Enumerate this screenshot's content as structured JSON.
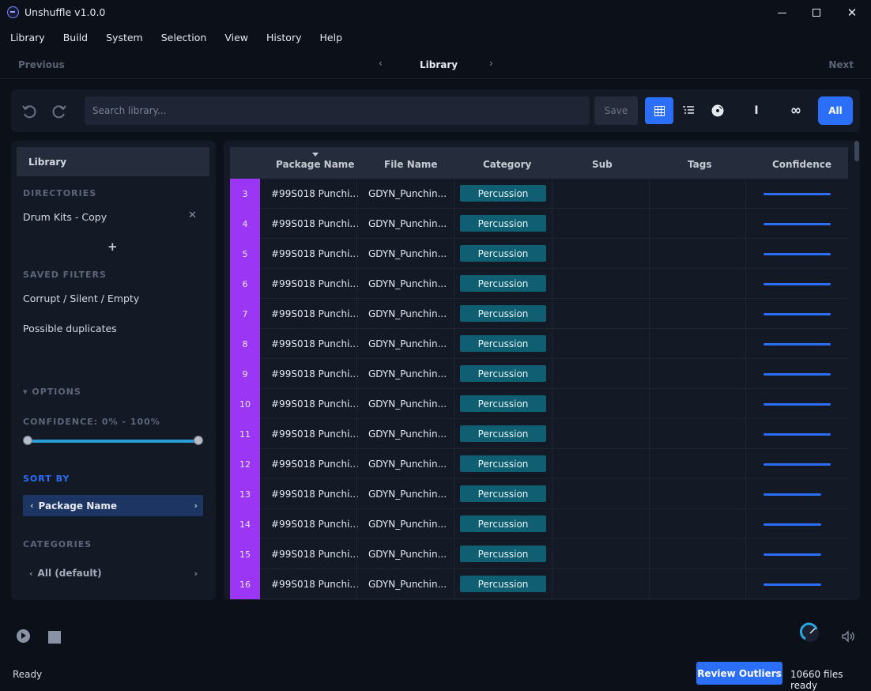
{
  "window": {
    "title": "Unshuffle v1.0.0"
  },
  "menu": [
    "Library",
    "Build",
    "System",
    "Selection",
    "View",
    "History",
    "Help"
  ],
  "nav": {
    "previous": "Previous",
    "title": "Library",
    "next": "Next"
  },
  "toolbar": {
    "search_placeholder": "Search library...",
    "save_label": "Save",
    "one_label": "I",
    "infinity_label": "∞",
    "all_label": "All",
    "accent": "#2b6ef7"
  },
  "sidebar": {
    "header": "Library",
    "directories_title": "DIRECTORIES",
    "directory_item": "Drum Kits - Copy",
    "add_label": "+",
    "saved_filters_title": "SAVED FILTERS",
    "saved_filters": [
      "Corrupt / Silent / Empty",
      "Possible duplicates"
    ],
    "options_title": "▾ OPTIONS",
    "confidence_title": "CONFIDENCE: 0% - 100%",
    "confidence_min": 0,
    "confidence_max": 100,
    "sort_by_title": "SORT BY",
    "sort_by_value": "Package Name",
    "categories_title": "CATEGORIES",
    "categories_value": "All (default)"
  },
  "table": {
    "columns": [
      "Package Name",
      "File Name",
      "Category",
      "Sub",
      "Tags",
      "Confidence"
    ],
    "row_accent": "#9b37f4",
    "category_color": "#0f5e72",
    "rows": [
      {
        "num": "3",
        "package": "#99S018 Punchi...",
        "file": "GDYN_Punchin...",
        "category": "Percussion",
        "confidence": 1.0
      },
      {
        "num": "4",
        "package": "#99S018 Punchi...",
        "file": "GDYN_Punchin...",
        "category": "Percussion",
        "confidence": 1.0
      },
      {
        "num": "5",
        "package": "#99S018 Punchi...",
        "file": "GDYN_Punchin...",
        "category": "Percussion",
        "confidence": 1.0
      },
      {
        "num": "6",
        "package": "#99S018 Punchi...",
        "file": "GDYN_Punchin...",
        "category": "Percussion",
        "confidence": 1.0
      },
      {
        "num": "7",
        "package": "#99S018 Punchi...",
        "file": "GDYN_Punchin...",
        "category": "Percussion",
        "confidence": 1.0
      },
      {
        "num": "8",
        "package": "#99S018 Punchi...",
        "file": "GDYN_Punchin...",
        "category": "Percussion",
        "confidence": 1.0
      },
      {
        "num": "9",
        "package": "#99S018 Punchi...",
        "file": "GDYN_Punchin...",
        "category": "Percussion",
        "confidence": 1.0
      },
      {
        "num": "10",
        "package": "#99S018 Punchi...",
        "file": "GDYN_Punchin...",
        "category": "Percussion",
        "confidence": 1.0
      },
      {
        "num": "11",
        "package": "#99S018 Punchi...",
        "file": "GDYN_Punchin...",
        "category": "Percussion",
        "confidence": 1.0
      },
      {
        "num": "12",
        "package": "#99S018 Punchi...",
        "file": "GDYN_Punchin...",
        "category": "Percussion",
        "confidence": 1.0
      },
      {
        "num": "13",
        "package": "#99S018 Punchi...",
        "file": "GDYN_Punchin...",
        "category": "Percussion",
        "confidence": 0.86
      },
      {
        "num": "14",
        "package": "#99S018 Punchi...",
        "file": "GDYN_Punchin...",
        "category": "Percussion",
        "confidence": 0.86
      },
      {
        "num": "15",
        "package": "#99S018 Punchi...",
        "file": "GDYN_Punchin...",
        "category": "Percussion",
        "confidence": 0.86
      },
      {
        "num": "16",
        "package": "#99S018 Punchi...",
        "file": "GDYN_Punchin...",
        "category": "Percussion",
        "confidence": 0.86
      }
    ]
  },
  "status": {
    "text": "Ready",
    "review_label": "Review Outliers",
    "files_ready": "10660 files ready"
  },
  "icons": [
    "app-logo-icon",
    "undo-icon",
    "redo-icon",
    "grid-view-icon",
    "list-view-icon",
    "disc-icon",
    "close-icon",
    "play-icon",
    "stop-icon",
    "volume-knob-icon",
    "speaker-icon"
  ]
}
